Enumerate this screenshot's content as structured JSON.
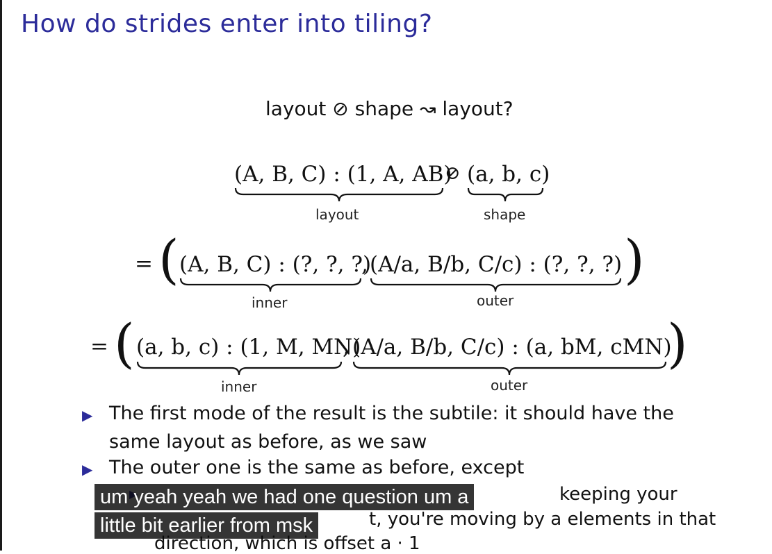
{
  "slide": {
    "title": "How do strides enter into tiling?",
    "headline": "layout ⊘ shape ↝ layout?",
    "eq1": {
      "layout_expr": "(A, B, C) : (1, A, AB)",
      "op": "⊘",
      "shape_expr": "(a, b, c)",
      "layout_label": "layout",
      "shape_label": "shape"
    },
    "eq2": {
      "equals": "=",
      "inner_expr": "(A, B, C) : (?, ?, ?)",
      "comma": ",",
      "outer_expr": "(A/a, B/b, C/c) : (?, ?, ?)",
      "inner_label": "inner",
      "outer_label": "outer"
    },
    "eq3": {
      "equals": "=",
      "inner_expr": "(a, b, c) : (1, M, MN)",
      "comma": ",",
      "outer_expr": "(A/a, B/b, C/c) : (a, bM, cMN)",
      "inner_label": "inner",
      "outer_label": "outer"
    },
    "bullets": [
      {
        "marker": "▶",
        "line1": "The first mode of the result is the subtile: it should have the",
        "line2": "same layout as before, as we saw"
      },
      {
        "marker": "▶",
        "line1": "The outer one is the same as before, except"
      }
    ],
    "sub_bullet": {
      "marker": "▶",
      "line1_tail": "keeping your",
      "line2_tail": "t, you're moving by a elements in that",
      "line3": "direction, which is offset a · 1"
    }
  },
  "caption": {
    "line1": "um yeah yeah we had one question um a",
    "line2": "little bit earlier from msk"
  },
  "colors": {
    "title": "#2c2c9a",
    "bullet": "#2c2c9a",
    "caption_bg": "#080808"
  }
}
